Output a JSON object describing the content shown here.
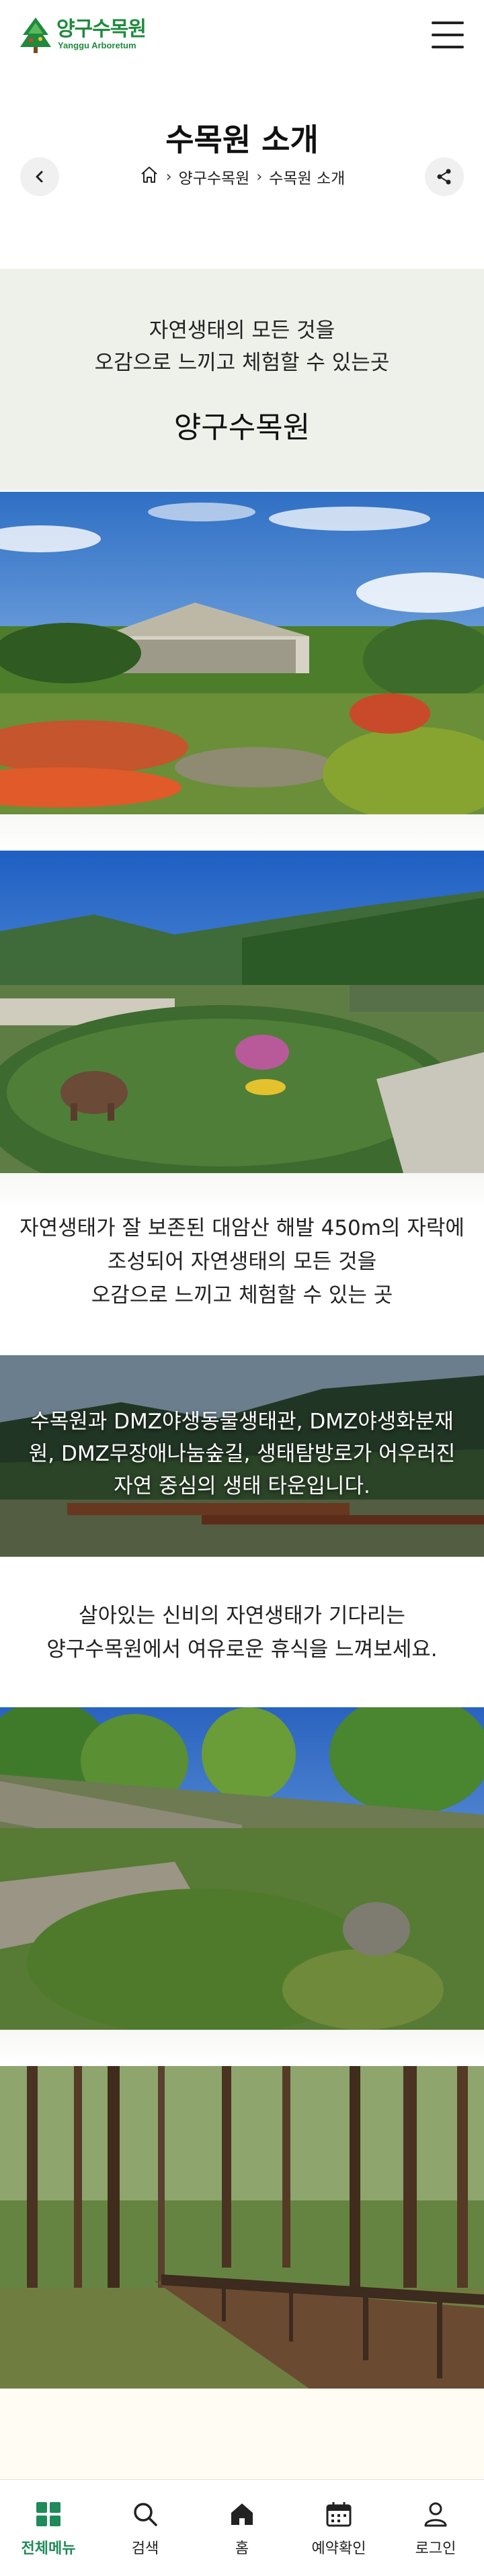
{
  "header": {
    "logo_korean": "양구수목원",
    "logo_english": "Yanggu Arboretum"
  },
  "title": {
    "page_title": "수목원 소개"
  },
  "breadcrumb": {
    "items": [
      "양구수목원",
      "수목원 소개"
    ]
  },
  "intro": {
    "line1": "자연생태의 모든 것을",
    "line2": "오감으로 느끼고 체험할 수 있는곳",
    "name": "양구수목원"
  },
  "section2": {
    "line1": "자연생태가 잘 보존된 대암산 해발 450m의 자락에",
    "line2": "조성되어 자연생태의 모든 것을",
    "line3": "오감으로 느끼고 체험할 수 있는 곳"
  },
  "overlay": {
    "line1": "수목원과 DMZ야생동물생태관, DMZ야생화분재",
    "line2": "원, DMZ무장애나눔숲길, 생태탐방로가 어우러진",
    "line3": "자연 중심의 생태 타운입니다."
  },
  "section3": {
    "line1": "살아있는 신비의 자연생태가 기다리는",
    "line2": "양구수목원에서 여유로운 휴식을 느껴보세요."
  },
  "bottom_nav": {
    "items": [
      {
        "label": "전체메뉴",
        "icon": "grid-icon",
        "active": true
      },
      {
        "label": "검색",
        "icon": "search-icon",
        "active": false
      },
      {
        "label": "홈",
        "icon": "home-icon",
        "active": false
      },
      {
        "label": "예약확인",
        "icon": "calendar-icon",
        "active": false
      },
      {
        "label": "로그인",
        "icon": "user-icon",
        "active": false
      }
    ]
  },
  "colors": {
    "brand_green": "#1e8a3c",
    "active_nav": "#1f8a5a",
    "intro_bg": "#eef1ea"
  }
}
